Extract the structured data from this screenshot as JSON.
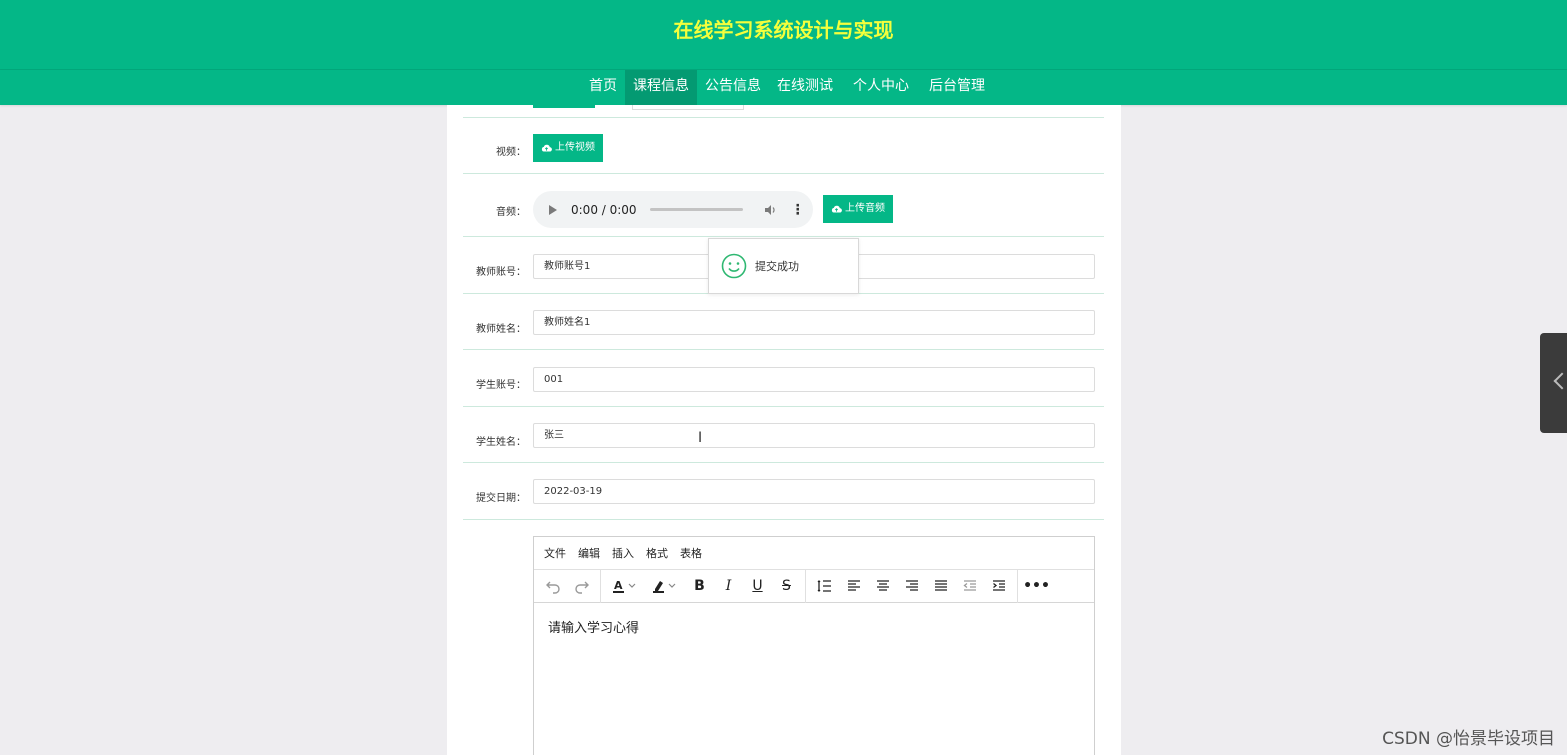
{
  "header": {
    "title": "在线学习系统设计与实现"
  },
  "nav": {
    "items": [
      {
        "label": "首页",
        "active": false
      },
      {
        "label": "课程信息",
        "active": true
      },
      {
        "label": "公告信息",
        "active": false
      },
      {
        "label": "在线测试",
        "active": false
      },
      {
        "label": "个人中心",
        "active": false
      },
      {
        "label": "后台管理",
        "active": false
      }
    ]
  },
  "form": {
    "video": {
      "label": "视频：",
      "button": "上传视频"
    },
    "audio": {
      "label": "音频：",
      "time": "0:00 / 0:00",
      "button": "上传音频"
    },
    "teacher_account": {
      "label": "教师账号：",
      "value": "教师账号1"
    },
    "teacher_name": {
      "label": "教师姓名：",
      "value": "教师姓名1"
    },
    "student_account": {
      "label": "学生账号：",
      "value": "001"
    },
    "student_name": {
      "label": "学生姓名：",
      "value": "张三"
    },
    "submit_date": {
      "label": "提交日期：",
      "value": "2022-03-19"
    }
  },
  "toast": {
    "text": "提交成功"
  },
  "editor": {
    "menu": [
      "文件",
      "编辑",
      "插入",
      "格式",
      "表格"
    ],
    "placeholder": "请输入学习心得"
  },
  "watermark": "CSDN @怡景毕设项目",
  "colors": {
    "primary": "#04b787",
    "title": "#f4ff3c"
  }
}
